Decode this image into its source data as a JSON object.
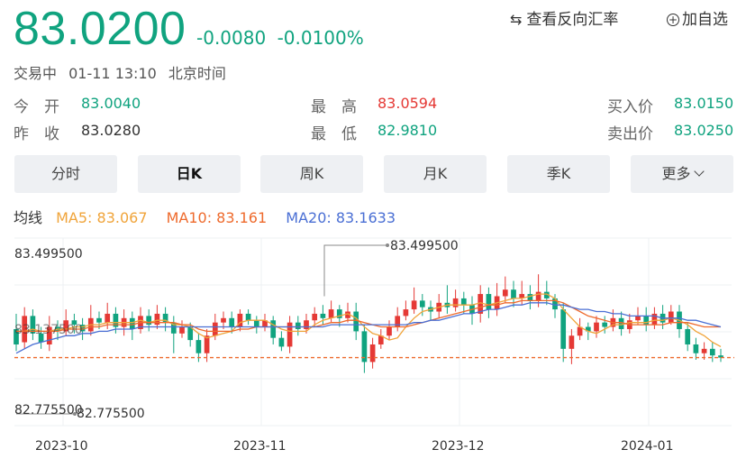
{
  "quote": {
    "price": "83.0200",
    "change": "-0.0080",
    "change_pct": "-0.0100%",
    "status": "交易中",
    "datetime": "01-11 13:10",
    "timezone": "北京时间"
  },
  "actions": {
    "swap_label": "查看反向汇率",
    "add_label": "加自选",
    "add_icon": "plus-circle-icon",
    "swap_icon": "swap-arrows-icon"
  },
  "stats": {
    "open_label": "今　开",
    "open": "83.0040",
    "prev_label": "昨　收",
    "prev": "83.0280",
    "high_label": "最　高",
    "high": "83.0594",
    "low_label": "最　低",
    "low": "82.9810",
    "bid_label": "买入价",
    "bid": "83.0150",
    "ask_label": "卖出价",
    "ask": "83.0250"
  },
  "tabs": [
    {
      "label": "分时"
    },
    {
      "label": "日K",
      "active": true
    },
    {
      "label": "周K"
    },
    {
      "label": "月K"
    },
    {
      "label": "季K"
    },
    {
      "label": "更多"
    }
  ],
  "ma_legend": {
    "title": "均线",
    "ma5": "MA5: 83.067",
    "ma10": "MA10: 83.161",
    "ma20": "MA20: 83.1633"
  },
  "colors": {
    "up": "#e53935",
    "down": "#10a37f",
    "ma5": "#f0a43a",
    "ma10": "#ee6a2c",
    "ma20": "#4a6fd4"
  },
  "chart_data": {
    "type": "candlestick",
    "ylabels": [
      "83.499500",
      "83.137500",
      "82.775500"
    ],
    "max_annotation": "83.499500",
    "min_annotation": "82.775500",
    "xlabels": [
      "2023-10",
      "2023-11",
      "2023-12",
      "2024-01"
    ],
    "ylim": [
      82.7755,
      83.4995
    ],
    "current_price_line": 83.02,
    "candles": [
      [
        83.15,
        83.08,
        83.22,
        83.05
      ],
      [
        83.09,
        83.21,
        83.25,
        83.06
      ],
      [
        83.21,
        83.13,
        83.24,
        83.1
      ],
      [
        83.13,
        83.09,
        83.16,
        83.06
      ],
      [
        83.08,
        83.16,
        83.21,
        83.05
      ],
      [
        83.16,
        83.14,
        83.19,
        83.1
      ],
      [
        83.14,
        83.19,
        83.24,
        83.12
      ],
      [
        83.19,
        83.17,
        83.22,
        83.13
      ],
      [
        83.17,
        83.14,
        83.2,
        83.1
      ],
      [
        83.14,
        83.2,
        83.26,
        83.12
      ],
      [
        83.2,
        83.18,
        83.23,
        83.15
      ],
      [
        83.18,
        83.22,
        83.27,
        83.15
      ],
      [
        83.22,
        83.16,
        83.25,
        83.13
      ],
      [
        83.16,
        83.2,
        83.24,
        83.12
      ],
      [
        83.2,
        83.15,
        83.23,
        83.1
      ],
      [
        83.15,
        83.21,
        83.25,
        83.13
      ],
      [
        83.21,
        83.17,
        83.24,
        83.14
      ],
      [
        83.17,
        83.22,
        83.26,
        83.15
      ],
      [
        83.22,
        83.18,
        83.25,
        83.14
      ],
      [
        83.18,
        83.13,
        83.21,
        83.04
      ],
      [
        83.13,
        83.16,
        83.19,
        83.11
      ],
      [
        83.16,
        83.1,
        83.18,
        83.07
      ],
      [
        83.1,
        83.04,
        83.13,
        83.0
      ],
      [
        83.04,
        83.12,
        83.15,
        83.0
      ],
      [
        83.12,
        83.18,
        83.22,
        83.1
      ],
      [
        83.18,
        83.2,
        83.23,
        83.15
      ],
      [
        83.2,
        83.16,
        83.23,
        83.13
      ],
      [
        83.16,
        83.22,
        83.24,
        83.14
      ],
      [
        83.22,
        83.19,
        83.24,
        83.17
      ],
      [
        83.19,
        83.16,
        83.21,
        83.13
      ],
      [
        83.16,
        83.19,
        83.22,
        83.14
      ],
      [
        83.19,
        83.11,
        83.21,
        83.08
      ],
      [
        83.11,
        83.07,
        83.14,
        83.05
      ],
      [
        83.07,
        83.18,
        83.21,
        83.04
      ],
      [
        83.18,
        83.15,
        83.21,
        83.12
      ],
      [
        83.15,
        83.19,
        83.22,
        83.13
      ],
      [
        83.19,
        83.22,
        83.25,
        83.16
      ],
      [
        83.22,
        83.2,
        83.26,
        83.17
      ],
      [
        83.2,
        83.24,
        83.28,
        83.18
      ],
      [
        83.24,
        83.2,
        83.26,
        83.16
      ],
      [
        83.2,
        83.23,
        83.27,
        83.18
      ],
      [
        83.23,
        83.14,
        83.27,
        83.1
      ],
      [
        83.14,
        83.0,
        83.17,
        82.95
      ],
      [
        83.0,
        83.08,
        83.11,
        82.97
      ],
      [
        83.08,
        83.12,
        83.15,
        83.06
      ],
      [
        83.12,
        83.16,
        83.19,
        83.1
      ],
      [
        83.16,
        83.21,
        83.25,
        83.14
      ],
      [
        83.21,
        83.24,
        83.28,
        83.19
      ],
      [
        83.24,
        83.28,
        83.34,
        83.22
      ],
      [
        83.28,
        83.25,
        83.31,
        83.21
      ],
      [
        83.25,
        83.23,
        83.28,
        83.19
      ],
      [
        83.23,
        83.27,
        83.31,
        83.2
      ],
      [
        83.27,
        83.25,
        83.35,
        83.22
      ],
      [
        83.25,
        83.29,
        83.33,
        83.23
      ],
      [
        83.29,
        83.26,
        83.32,
        83.22
      ],
      [
        83.26,
        83.22,
        83.3,
        83.17
      ],
      [
        83.22,
        83.31,
        83.35,
        83.18
      ],
      [
        83.31,
        83.24,
        83.34,
        83.2
      ],
      [
        83.24,
        83.3,
        83.36,
        83.21
      ],
      [
        83.3,
        83.33,
        83.39,
        83.27
      ],
      [
        83.33,
        83.29,
        83.37,
        83.25
      ],
      [
        83.29,
        83.31,
        83.37,
        83.26
      ],
      [
        83.31,
        83.28,
        83.35,
        83.24
      ],
      [
        83.28,
        83.32,
        83.4,
        83.25
      ],
      [
        83.32,
        83.29,
        83.37,
        83.26
      ],
      [
        83.29,
        83.24,
        83.31,
        83.2
      ],
      [
        83.24,
        83.06,
        83.27,
        83.0
      ],
      [
        83.06,
        83.12,
        83.15,
        82.99
      ],
      [
        83.12,
        83.16,
        83.2,
        83.1
      ],
      [
        83.16,
        83.14,
        83.18,
        83.1
      ],
      [
        83.14,
        83.18,
        83.21,
        83.11
      ],
      [
        83.18,
        83.16,
        83.21,
        83.13
      ],
      [
        83.16,
        83.2,
        83.24,
        83.14
      ],
      [
        83.2,
        83.15,
        83.23,
        83.12
      ],
      [
        83.15,
        83.19,
        83.22,
        83.13
      ],
      [
        83.19,
        83.21,
        83.25,
        83.17
      ],
      [
        83.21,
        83.17,
        83.25,
        83.14
      ],
      [
        83.17,
        83.22,
        83.25,
        83.15
      ],
      [
        83.22,
        83.18,
        83.26,
        83.15
      ],
      [
        83.18,
        83.23,
        83.26,
        83.17
      ],
      [
        83.23,
        83.15,
        83.26,
        83.11
      ],
      [
        83.15,
        83.08,
        83.18,
        83.05
      ],
      [
        83.08,
        83.04,
        83.11,
        83.01
      ],
      [
        83.04,
        83.06,
        83.09,
        83.01
      ],
      [
        83.06,
        83.03,
        83.09,
        83.0
      ],
      [
        83.03,
        83.02,
        83.06,
        83.0
      ]
    ],
    "ma5": [
      83.14,
      83.14,
      83.15,
      83.14,
      83.14,
      83.15,
      83.15,
      83.16,
      83.16,
      83.17,
      83.17,
      83.18,
      83.18,
      83.18,
      83.18,
      83.19,
      83.18,
      83.19,
      83.19,
      83.17,
      83.17,
      83.16,
      83.13,
      83.11,
      83.12,
      83.13,
      83.14,
      83.18,
      83.19,
      83.19,
      83.19,
      83.17,
      83.15,
      83.14,
      83.14,
      83.14,
      83.17,
      83.19,
      83.2,
      83.21,
      83.22,
      83.2,
      83.16,
      83.13,
      83.12,
      83.1,
      83.11,
      83.16,
      83.2,
      83.23,
      83.24,
      83.25,
      83.26,
      83.26,
      83.26,
      83.26,
      83.27,
      83.26,
      83.27,
      83.28,
      83.29,
      83.29,
      83.3,
      83.31,
      83.31,
      83.29,
      83.24,
      83.2,
      83.16,
      83.14,
      83.13,
      83.15,
      83.17,
      83.17,
      83.18,
      83.18,
      83.18,
      83.19,
      83.19,
      83.2,
      83.19,
      83.17,
      83.14,
      83.12,
      83.09,
      83.07
    ],
    "ma10": [
      83.14,
      83.14,
      83.14,
      83.14,
      83.14,
      83.14,
      83.15,
      83.15,
      83.15,
      83.16,
      83.16,
      83.17,
      83.17,
      83.17,
      83.17,
      83.18,
      83.18,
      83.18,
      83.18,
      83.18,
      83.17,
      83.17,
      83.15,
      83.14,
      83.14,
      83.14,
      83.14,
      83.15,
      83.15,
      83.16,
      83.16,
      83.16,
      83.16,
      83.16,
      83.16,
      83.16,
      83.16,
      83.17,
      83.18,
      83.18,
      83.19,
      83.19,
      83.18,
      83.17,
      83.16,
      83.16,
      83.16,
      83.16,
      83.17,
      83.18,
      83.19,
      83.2,
      83.21,
      83.22,
      83.23,
      83.24,
      83.25,
      83.26,
      83.26,
      83.27,
      83.27,
      83.28,
      83.28,
      83.28,
      83.28,
      83.28,
      83.27,
      83.25,
      83.23,
      83.21,
      83.2,
      83.19,
      83.18,
      83.18,
      83.17,
      83.17,
      83.17,
      83.17,
      83.17,
      83.18,
      83.18,
      83.18,
      83.17,
      83.16,
      83.16,
      83.16
    ],
    "ma20": [
      83.04,
      83.06,
      83.08,
      83.09,
      83.1,
      83.11,
      83.12,
      83.12,
      83.13,
      83.13,
      83.14,
      83.14,
      83.15,
      83.15,
      83.15,
      83.16,
      83.16,
      83.16,
      83.16,
      83.16,
      83.16,
      83.16,
      83.16,
      83.16,
      83.16,
      83.16,
      83.16,
      83.16,
      83.16,
      83.16,
      83.16,
      83.16,
      83.16,
      83.16,
      83.16,
      83.16,
      83.16,
      83.16,
      83.17,
      83.17,
      83.17,
      83.17,
      83.17,
      83.17,
      83.17,
      83.17,
      83.17,
      83.17,
      83.18,
      83.18,
      83.19,
      83.19,
      83.2,
      83.21,
      83.22,
      83.22,
      83.23,
      83.24,
      83.24,
      83.25,
      83.26,
      83.26,
      83.27,
      83.27,
      83.27,
      83.26,
      83.26,
      83.25,
      83.24,
      83.24,
      83.23,
      83.23,
      83.22,
      83.22,
      83.21,
      83.21,
      83.21,
      83.21,
      83.2,
      83.2,
      83.2,
      83.19,
      83.19,
      83.18,
      83.17,
      83.16
    ]
  }
}
